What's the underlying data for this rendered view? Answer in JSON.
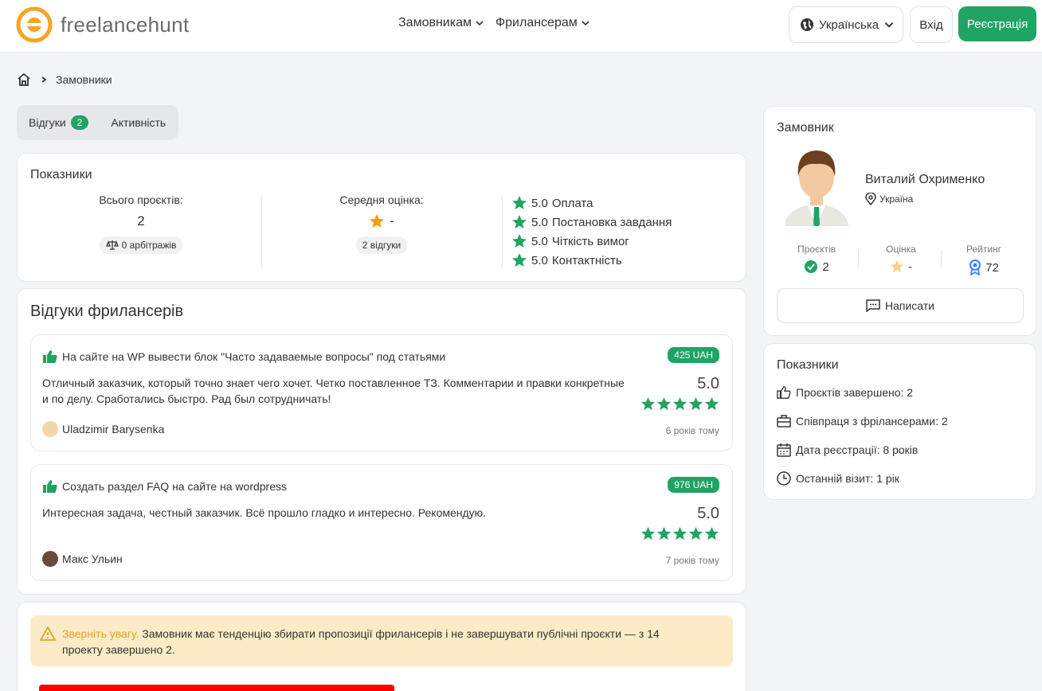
{
  "header": {
    "brand": "freelancehunt",
    "nav": [
      "Замовникам",
      "Фрилансерам"
    ],
    "language": "Українська",
    "login": "Вхід",
    "register": "Реєстрація",
    "colors": {
      "accent": "#1fa463",
      "logo": "#f5a623"
    }
  },
  "breadcrumb": {
    "current": "Замовники"
  },
  "tabs": {
    "reviews": "Відгуки",
    "reviews_count": "2",
    "activity": "Активність"
  },
  "stats": {
    "title": "Показники",
    "total_projects_label": "Всього проєктів:",
    "total_projects": "2",
    "arbitrations": "0 арбітражів",
    "avg_rating_label": "Середня оцінка:",
    "avg_rating": "-",
    "reviews_pill": "2 відгуки",
    "ratings": [
      {
        "score": "5.0",
        "label": "Оплата"
      },
      {
        "score": "5.0",
        "label": "Постановка завдання"
      },
      {
        "score": "5.0",
        "label": "Чіткість вимог"
      },
      {
        "score": "5.0",
        "label": "Контактність"
      }
    ]
  },
  "reviews": {
    "title": "Відгуки фрилансерів",
    "items": [
      {
        "project": "На сайте на WP вывести блок \"Часто задаваемые вопросы\" под статьями",
        "price": "425 UAH",
        "text": "Отличный заказчик, который точно знает чего хочет. Четко поставленное ТЗ. Комментарии и правки конкретные и по делу. Сработались быстро. Рад был сотрудничать!",
        "score": "5.0",
        "stars": 5,
        "author": "Uladzimir Barysenka",
        "time": "6 років тому"
      },
      {
        "project": "Создать раздел FAQ на сайте на wordpress",
        "price": "976 UAH",
        "text": "Интересная задача, честный заказчик. Всё прошло гладко и интересно. Рекомендую.",
        "score": "5.0",
        "stars": 5,
        "author": "Макс Ульин",
        "time": "7 років тому"
      }
    ]
  },
  "warning": {
    "strong": "Зверніть увагу.",
    "text": " Замовник має тенденцію збирати пропозиції фрилансерів і не завершувати публічні проєкти — з 14 проекту завершено 2."
  },
  "profile": {
    "title": "Замовник",
    "name": "Виталий Охрименко",
    "country": "Україна",
    "projects_label": "Проєктів",
    "projects": "2",
    "rating_label": "Оцінка",
    "rating": "-",
    "rank_label": "Рейтинг",
    "rank": "72",
    "write": "Написати"
  },
  "side_stats": {
    "title": "Показники",
    "rows": [
      {
        "icon": "thumbs-up-icon",
        "text": "Проєктів завершено: 2"
      },
      {
        "icon": "briefcase-icon",
        "text": "Співпраця з фрілансерами: 2"
      },
      {
        "icon": "calendar-icon",
        "text": "Дата реєстрації: 8 років"
      },
      {
        "icon": "clock-icon",
        "text": "Останній візит: 1 рік"
      }
    ]
  }
}
